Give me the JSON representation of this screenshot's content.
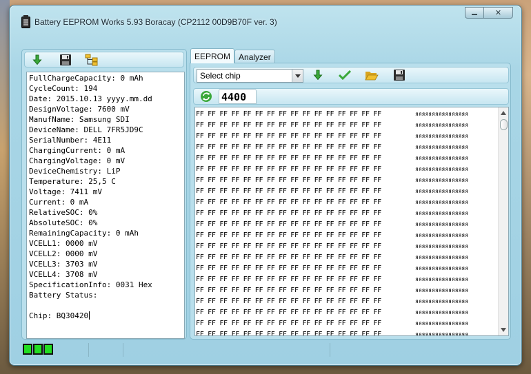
{
  "window": {
    "title": "Battery EEPROM Works  5.93 Boracay (CP2112 00D9B70F ver. 3)",
    "minimize_label": "",
    "close_label": "✕"
  },
  "left_toolbar": {
    "icons": [
      "download-arrow-icon",
      "save-icon",
      "tree-icon"
    ]
  },
  "info_lines": [
    "FullChargeCapacity: 0 mAh",
    "CycleCount: 194",
    "Date: 2015.10.13 yyyy.mm.dd",
    "DesignVoltage: 7600 mV",
    "ManufName: Samsung SDI",
    "DeviceName: DELL 7FR5JD9C",
    "SerialNumber: 4E11",
    "ChargingCurrent: 0 mA",
    "ChargingVoltage: 0 mV",
    "DeviceChemistry: LiP",
    "Temperature: 25,5 C",
    "Voltage: 7411 mV",
    "Current: 0 mA",
    "RelativeSOC: 0%",
    "AbsoluteSOC: 0%",
    "RemainingCapacity: 0 mAh",
    "VCELL1: 0000 mV",
    "VCELL2: 0000 mV",
    "VCELL3: 3703 mV",
    "VCELL4: 3708 mV",
    "SpecificationInfo: 0031 Hex",
    "Battery Status:",
    "",
    "Chip: BQ30420"
  ],
  "tabs": [
    "EEPROM",
    "Analyzer"
  ],
  "chip_toolbar": {
    "select_value": "Select chip",
    "icons": [
      "download-arrow-icon",
      "check-icon",
      "open-folder-icon",
      "save-icon"
    ]
  },
  "address": "4400",
  "hex": {
    "byte_text": "FF FF FF FF FF FF FF FF FF FF FF FF FF FF FF FF",
    "ascii_text": "яяяяяяяяяяяяяяяя",
    "row_count": 21
  },
  "colors": {
    "battery_green": "#22dd22",
    "icon_green": "#3aa83a",
    "folder_yellow": "#f0c030"
  }
}
